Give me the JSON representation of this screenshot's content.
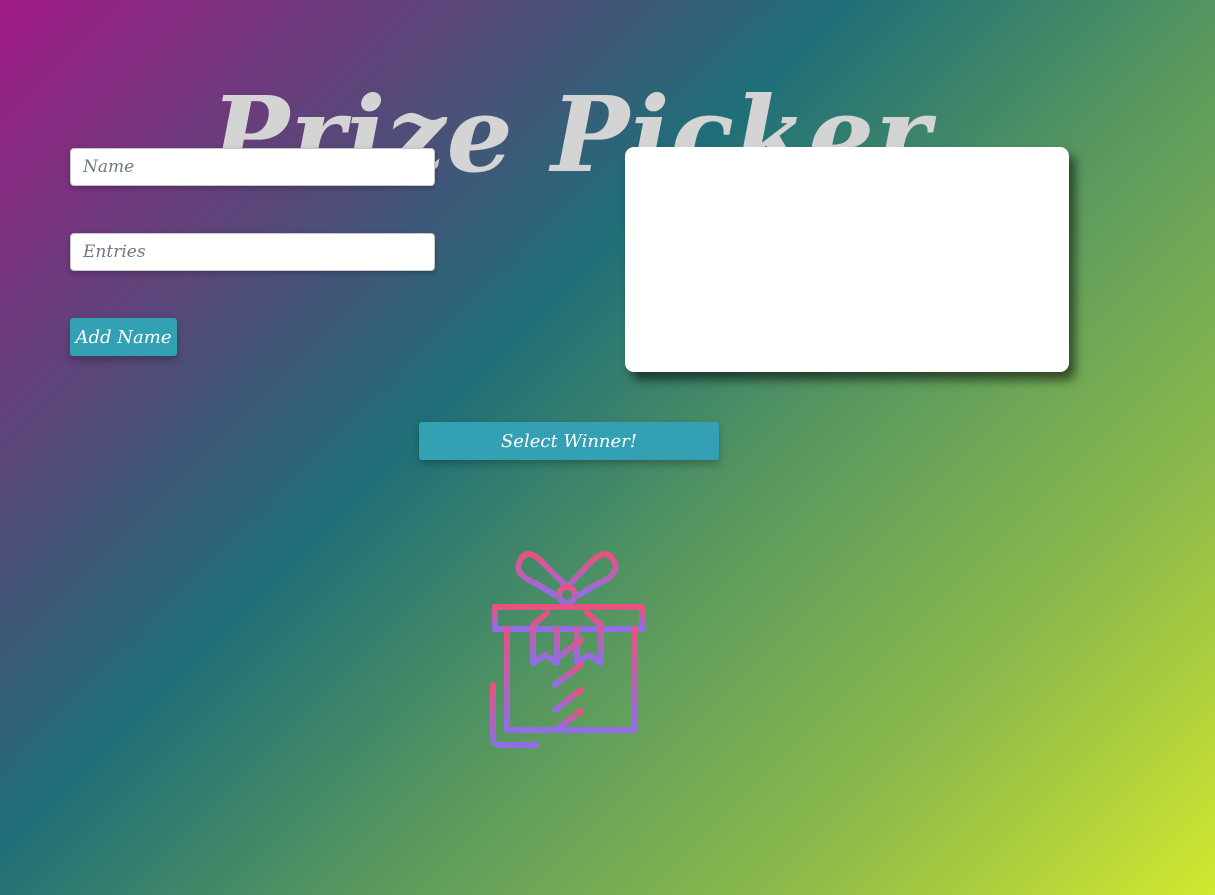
{
  "header": {
    "title": "Prize Picker"
  },
  "form": {
    "name_placeholder": "Name",
    "entries_placeholder": "Entries",
    "add_button_label": "Add Name"
  },
  "actions": {
    "select_winner_label": "Select Winner!"
  },
  "illustration": {
    "icon": "gift-icon",
    "gradient_top": "#e8527f",
    "gradient_bottom": "#8f6ee6"
  },
  "colors": {
    "button": "#33a0b4",
    "title": "#d4d4d4"
  }
}
